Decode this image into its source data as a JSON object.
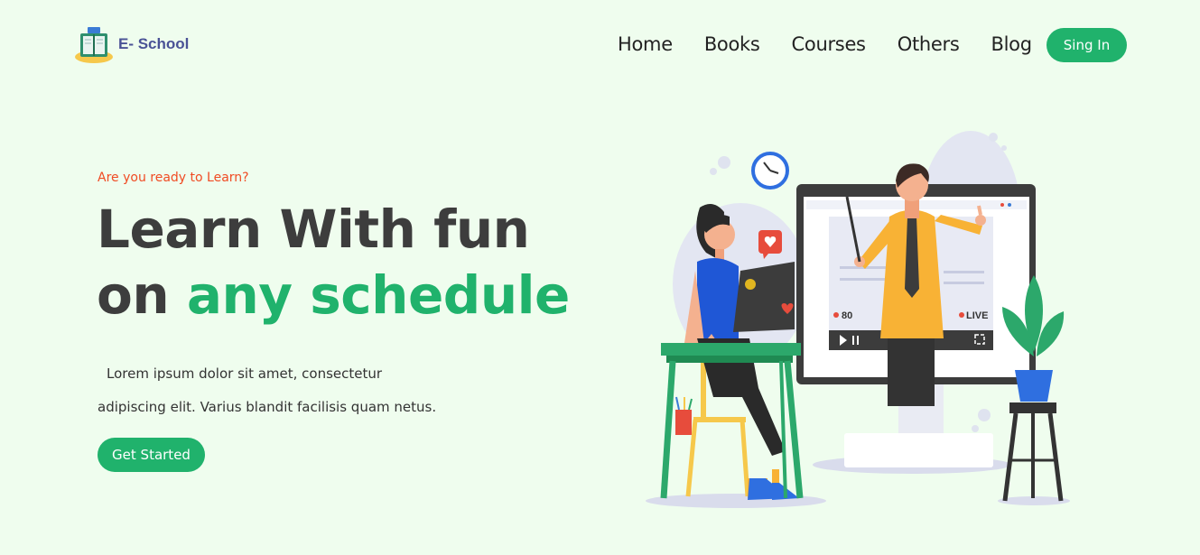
{
  "brand": {
    "name": "E- School",
    "icon": "book-logo-icon"
  },
  "nav": {
    "items": [
      {
        "label": "Home"
      },
      {
        "label": "Books"
      },
      {
        "label": "Courses"
      },
      {
        "label": "Others"
      },
      {
        "label": "Blog"
      }
    ],
    "signin_label": "Sing In"
  },
  "hero": {
    "kicker": "Are you ready to Learn?",
    "headline_line1": "Learn With fun",
    "headline_line2_prefix": "on ",
    "headline_line2_accent": "any schedule",
    "description_line1": "Lorem ipsum dolor sit amet, consectetur",
    "description_line2": "adipiscing elit. Varius blandit facilisis quam netus.",
    "cta_label": "Get Started"
  },
  "illustration": {
    "viewer_count": "80",
    "live_badge": "LIVE",
    "icons": [
      "clock-icon",
      "heart-icon",
      "play-icon",
      "pause-icon",
      "fullscreen-icon",
      "plant-icon"
    ]
  },
  "colors": {
    "background": "#effdee",
    "accent": "#20b26c",
    "kicker": "#f04b23",
    "heading": "#3d3d3d",
    "brand_text": "#4a5296"
  }
}
